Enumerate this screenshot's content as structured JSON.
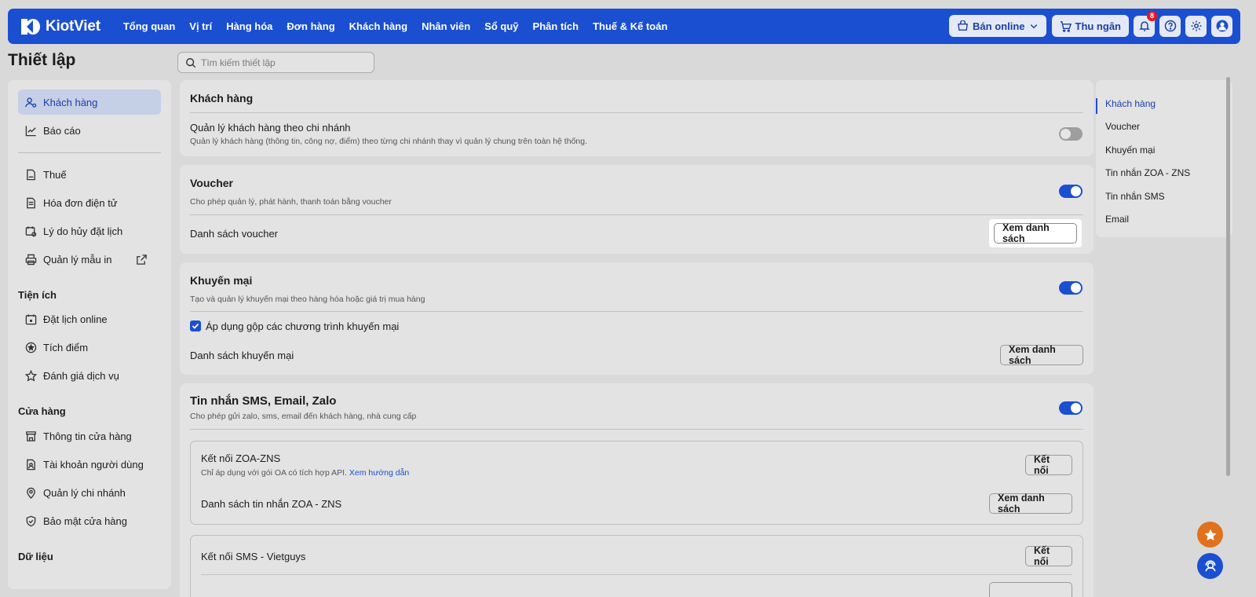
{
  "app": {
    "brand": "KiotViet"
  },
  "nav": {
    "links": [
      "Tổng quan",
      "Vị trí",
      "Hàng hóa",
      "Đơn hàng",
      "Khách hàng",
      "Nhân viên",
      "Sổ quỹ",
      "Phân tích",
      "Thuế & Kế toán"
    ],
    "online_label": "Bán online",
    "cashier_label": "Thu ngân",
    "notification_count": "8"
  },
  "page": {
    "title": "Thiết lập",
    "search_placeholder": "Tìm kiếm thiết lập"
  },
  "sidebar": {
    "top_items": [
      {
        "label": "Khách hàng",
        "icon": "user-gear-icon",
        "active": true
      },
      {
        "label": "Báo cáo",
        "icon": "chart-icon"
      }
    ],
    "items2": [
      {
        "label": "Thuế",
        "icon": "vat-doc-icon"
      },
      {
        "label": "Hóa đơn điện tử",
        "icon": "invoice-icon"
      },
      {
        "label": "Lý do hủy đặt lịch",
        "icon": "calendar-cancel-icon"
      },
      {
        "label": "Quản lý mẫu in",
        "icon": "printer-icon",
        "external": true
      }
    ],
    "section_utilities": "Tiện ích",
    "utilities": [
      {
        "label": "Đặt lịch online",
        "icon": "calendar-icon"
      },
      {
        "label": "Tích điểm",
        "icon": "star-circle-icon"
      },
      {
        "label": "Đánh giá dịch vụ",
        "icon": "star-icon"
      }
    ],
    "section_store": "Cửa hàng",
    "store": [
      {
        "label": "Thông tin cửa hàng",
        "icon": "store-icon"
      },
      {
        "label": "Tài khoản người dùng",
        "icon": "user-card-icon"
      },
      {
        "label": "Quản lý chi nhánh",
        "icon": "location-icon"
      },
      {
        "label": "Bảo mật cửa hàng",
        "icon": "shield-icon"
      }
    ],
    "section_data": "Dữ liệu"
  },
  "cards": {
    "customer": {
      "title": "Khách hàng",
      "setting_label": "Quản lý khách hàng theo chi nhánh",
      "setting_desc": "Quản lý khách hàng (thông tin, công nợ, điểm) theo từng chi nhánh thay vì quản lý chung trên toàn hệ thống.",
      "enabled": false
    },
    "voucher": {
      "title": "Voucher",
      "desc": "Cho phép quản lý, phát hành, thanh toán bằng voucher",
      "enabled": true,
      "list_label": "Danh sách voucher",
      "list_button": "Xem danh sách"
    },
    "promo": {
      "title": "Khuyến mại",
      "desc": "Tạo và quản lý khuyến mại theo hàng hóa hoặc giá trị mua hàng",
      "enabled": true,
      "combine_label": "Áp dụng gộp các chương trình khuyến mại",
      "list_label": "Danh sách khuyến mại",
      "list_button": "Xem danh sách"
    },
    "messaging": {
      "title": "Tin nhắn SMS, Email, Zalo",
      "desc": "Cho phép gửi zalo, sms, email đến khách hàng, nhà cung cấp",
      "enabled": true,
      "zns": {
        "title": "Kết nối ZOA-ZNS",
        "desc": "Chỉ áp dụng với gói OA có tích hợp API.",
        "guide_link": "Xem hướng dẫn",
        "connect_button": "Kết nối",
        "list_label": "Danh sách tin nhắn ZOA - ZNS",
        "list_button": "Xem danh sách"
      },
      "sms": {
        "title": "Kết nối SMS - Vietguys",
        "connect_button": "Kết nối"
      }
    }
  },
  "right_nav": {
    "items": [
      "Khách hàng",
      "Voucher",
      "Khuyến mại",
      "Tin nhắn ZOA - ZNS",
      "Tin nhắn SMS",
      "Email"
    ],
    "active_index": 0
  },
  "colors": {
    "primary": "#1b4fd1",
    "navbar": "#1b4fd1",
    "fab_star": "#e0711d",
    "badge": "#e01b24"
  }
}
